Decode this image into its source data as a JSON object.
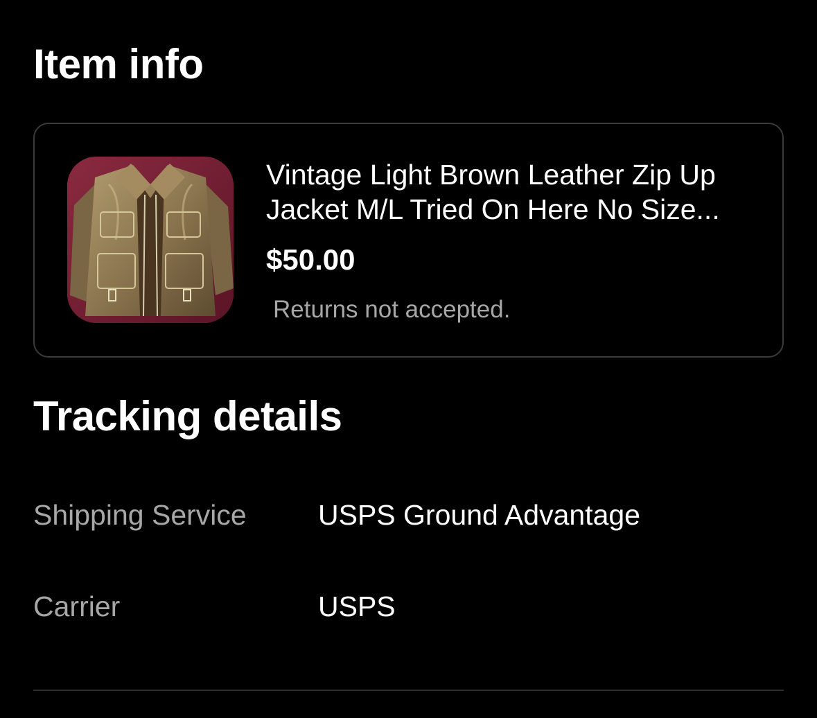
{
  "item_info": {
    "title": "Item info",
    "item": {
      "name": "Vintage Light Brown Leather Zip Up Jacket M/L Tried On Here No Size...",
      "price": "$50.00",
      "returns": "Returns not accepted.",
      "thumbnail": "leather-jacket-photo"
    }
  },
  "tracking": {
    "title": "Tracking details",
    "rows": [
      {
        "label": "Shipping Service",
        "value": "USPS Ground Advantage"
      },
      {
        "label": "Carrier",
        "value": "USPS"
      }
    ]
  },
  "colors": {
    "background": "#000000",
    "primary_text": "#ffffff",
    "secondary_text": "#a7a7a7",
    "card_border": "#3b3b3b"
  }
}
